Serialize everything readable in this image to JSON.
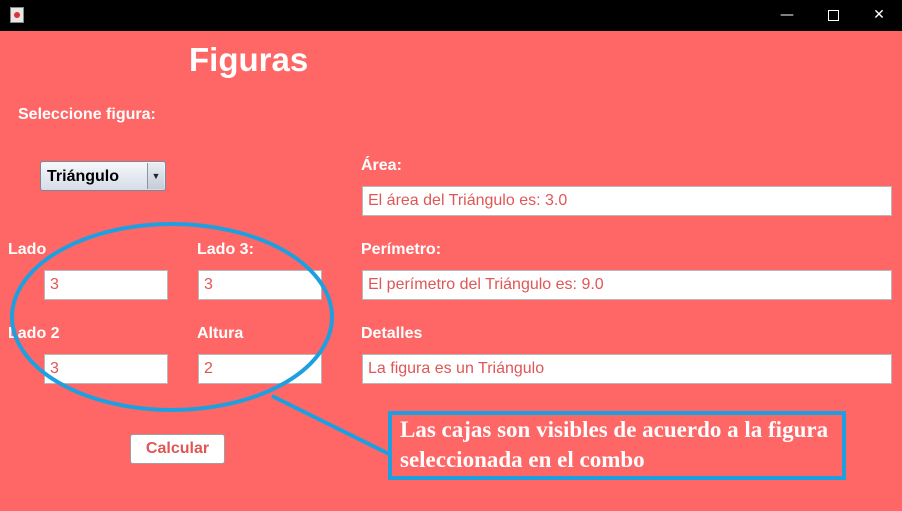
{
  "window": {
    "min_symbol": "—",
    "close_symbol": "✕"
  },
  "form": {
    "title": "Figuras",
    "select_label": "Seleccione figura:",
    "combo": {
      "selected": "Triángulo",
      "arrow": "▼"
    },
    "lado_label": "Lado",
    "lado_value": "3",
    "lado3_label": "Lado 3:",
    "lado3_value": "3",
    "lado2_label": "Lado 2",
    "lado2_value": "3",
    "altura_label": "Altura",
    "altura_value": "2",
    "calcular_label": "Calcular"
  },
  "results": {
    "area_label": "Área:",
    "area_value": "El área del Triángulo es: 3.0",
    "perimetro_label": "Perímetro:",
    "perimetro_value": "El perímetro del Triángulo es: 9.0",
    "detalles_label": "Detalles",
    "detalles_value": "La figura es un Triángulo"
  },
  "annotation": {
    "text": "Las cajas son visibles de acuerdo a la figura seleccionada en el combo",
    "color": "#1ea0e0"
  },
  "colors": {
    "background": "#ff6666",
    "field_text": "#e05656",
    "titlebar": "#000000"
  }
}
